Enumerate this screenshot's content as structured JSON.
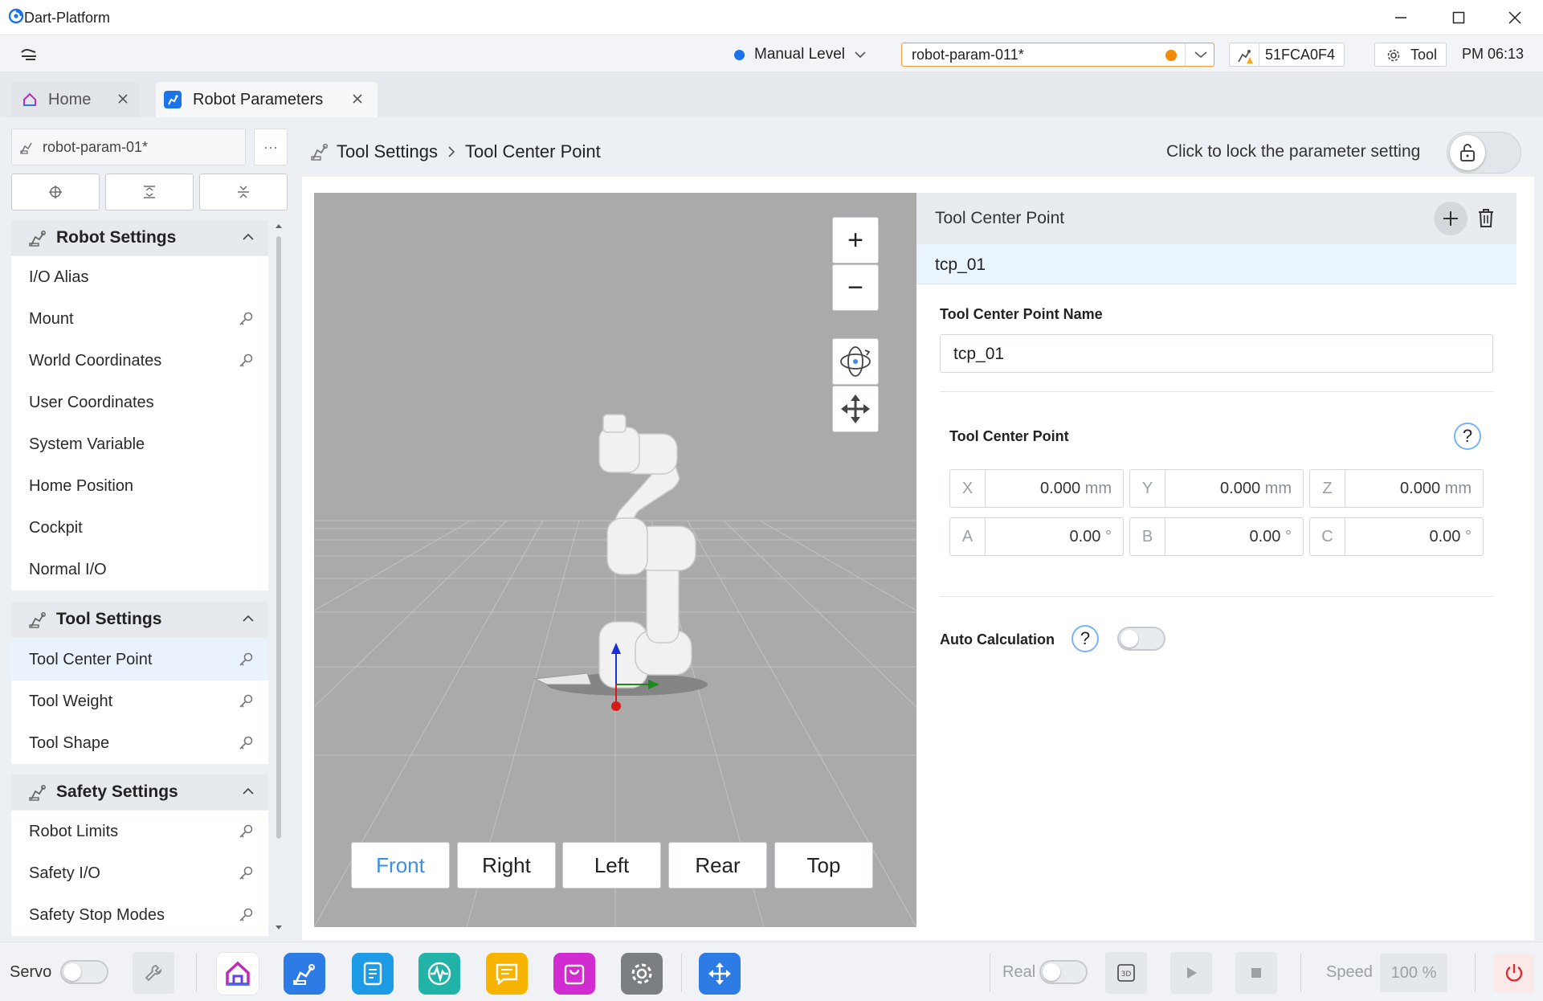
{
  "window": {
    "title": "Dart-Platform"
  },
  "status": {
    "manual_level": "Manual Level",
    "param_file": "robot-param-011*",
    "serial": "51FCA0F4",
    "tool_label": "Tool",
    "time": "PM 06:13"
  },
  "tabs": [
    {
      "label": "Home"
    },
    {
      "label": "Robot Parameters"
    }
  ],
  "sidebar": {
    "file": "robot-param-01*",
    "more": "···",
    "sections": [
      {
        "title": "Robot Settings",
        "items": [
          "I/O Alias",
          "Mount",
          "World Coordinates",
          "User Coordinates",
          "System Variable",
          "Home Position",
          "Cockpit",
          "Normal I/O"
        ]
      },
      {
        "title": "Tool Settings",
        "items": [
          "Tool Center Point",
          "Tool Weight",
          "Tool Shape"
        ]
      },
      {
        "title": "Safety Settings",
        "items": [
          "Robot Limits",
          "Safety I/O",
          "Safety Stop Modes"
        ]
      }
    ]
  },
  "breadcrumb": {
    "parent": "Tool Settings",
    "current": "Tool Center Point"
  },
  "lock_text": "Click to lock the parameter setting",
  "viewport": {
    "zoom_in": "+",
    "zoom_out": "−",
    "views": [
      "Front",
      "Right",
      "Left",
      "Rear",
      "Top"
    ],
    "active_view": "Front"
  },
  "tcp_panel": {
    "header": "Tool Center Point",
    "selected": "tcp_01",
    "name_label": "Tool Center Point Name",
    "name_value": "tcp_01",
    "coord_label": "Tool Center Point",
    "help": "?",
    "coords": [
      {
        "axis": "X",
        "value": "0.000",
        "unit": "mm"
      },
      {
        "axis": "Y",
        "value": "0.000",
        "unit": "mm"
      },
      {
        "axis": "Z",
        "value": "0.000",
        "unit": "mm"
      },
      {
        "axis": "A",
        "value": "0.00",
        "unit": "°"
      },
      {
        "axis": "B",
        "value": "0.00",
        "unit": "°"
      },
      {
        "axis": "C",
        "value": "0.00",
        "unit": "°"
      }
    ],
    "auto_calc_label": "Auto Calculation",
    "auto_calc_on": false
  },
  "bottom": {
    "servo": "Servo",
    "real": "Real",
    "speed_label": "Speed",
    "speed_value": "100 %"
  },
  "colors": {
    "accent": "#1a73e8",
    "param_dot": "#f58a07",
    "active_view": "#3a8ee6"
  }
}
